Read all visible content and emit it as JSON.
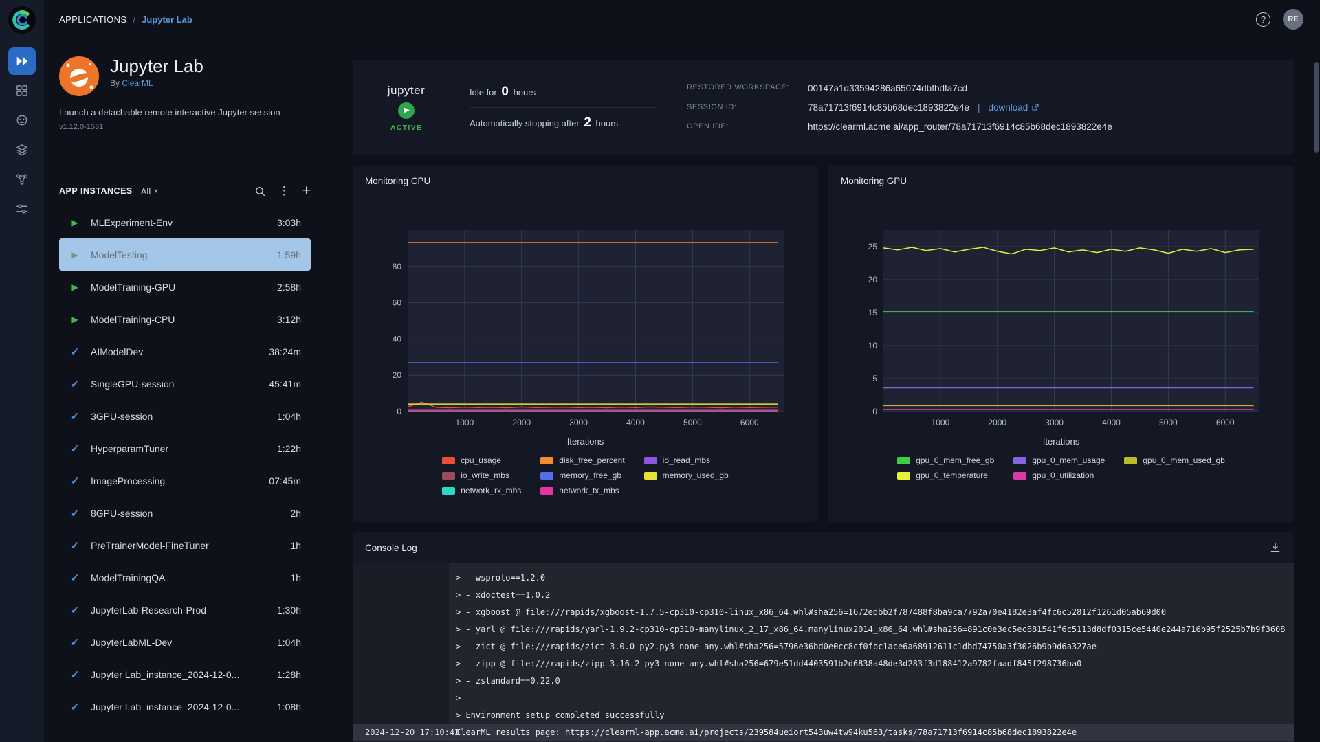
{
  "breadcrumb": {
    "section": "APPLICATIONS",
    "separator": "/",
    "current": "Jupyter Lab"
  },
  "header": {
    "avatar_initials": "RE"
  },
  "icons": {
    "play": "▶",
    "check": "✓",
    "kebab": "⋮",
    "plus": "+",
    "chevron_down": "▾",
    "help": "?"
  },
  "nav_rail": {
    "items": [
      "applications",
      "dashboard",
      "models",
      "datasets",
      "pipelines",
      "workers"
    ]
  },
  "app": {
    "title": "Jupyter Lab",
    "byline_prefix": "By",
    "byline_link": "ClearML",
    "description": "Launch a detachable remote interactive Jupyter session",
    "version": "v1.12.0-1531"
  },
  "instances_panel": {
    "title": "APP INSTANCES",
    "filter_label": "All",
    "instances": [
      {
        "name": "MLExperiment-Env",
        "duration": "3:03h",
        "status": "running"
      },
      {
        "name": "ModelTesting",
        "duration": "1:59h",
        "status": "running",
        "selected": true
      },
      {
        "name": "ModelTraining-GPU",
        "duration": "2:58h",
        "status": "running"
      },
      {
        "name": "ModelTraining-CPU",
        "duration": "3:12h",
        "status": "running"
      },
      {
        "name": "AIModelDev",
        "duration": "38:24m",
        "status": "completed"
      },
      {
        "name": "SingleGPU-session",
        "duration": "45:41m",
        "status": "completed"
      },
      {
        "name": "3GPU-session",
        "duration": "1:04h",
        "status": "completed"
      },
      {
        "name": "HyperparamTuner",
        "duration": "1:22h",
        "status": "completed"
      },
      {
        "name": "ImageProcessing",
        "duration": "07:45m",
        "status": "completed"
      },
      {
        "name": "8GPU-session",
        "duration": "2h",
        "status": "completed"
      },
      {
        "name": "PreTrainerModel-FineTuner",
        "duration": "1h",
        "status": "completed"
      },
      {
        "name": "ModelTrainingQA",
        "duration": "1h",
        "status": "completed"
      },
      {
        "name": "JupyterLab-Research-Prod",
        "duration": "1:30h",
        "status": "completed"
      },
      {
        "name": "JupyterLabML-Dev",
        "duration": "1:04h",
        "status": "completed"
      },
      {
        "name": "Jupyter Lab_instance_2024-12-0...",
        "duration": "1:28h",
        "status": "completed"
      },
      {
        "name": "Jupyter Lab_instance_2024-12-0...",
        "duration": "1:08h",
        "status": "completed"
      }
    ]
  },
  "session": {
    "logo_text": "jupyter",
    "status": "ACTIVE",
    "idle": {
      "prefix": "Idle for",
      "value": "0",
      "suffix": "hours"
    },
    "autostop": {
      "prefix": "Automatically stopping after",
      "value": "2",
      "suffix": "hours"
    },
    "info": [
      {
        "label": "RESTORED WORKSPACE:",
        "value": "00147a1d33594286a65074dbfbdfa7cd"
      },
      {
        "label": "SESSION ID:",
        "value": "78a71713f6914c85b68dec1893822e4e",
        "separator": "|",
        "link": "download"
      },
      {
        "label": "OPEN IDE:",
        "value": "https://clearml.acme.ai/app_router/78a71713f6914c85b68dec1893822e4e"
      }
    ]
  },
  "colors": {
    "accent_blue": "#5a9be0",
    "active_green": "#43b14b",
    "selected_row": "#a4c6e8",
    "running_icon": "#3fb94d",
    "completed_icon": "#4a97e8"
  },
  "chart_data": [
    {
      "type": "line",
      "title": "Monitoring CPU",
      "xlabel": "Iterations",
      "ylabel": "",
      "xlim": [
        0,
        6600
      ],
      "ylim": [
        0,
        100
      ],
      "xticks": [
        1000,
        2000,
        3000,
        4000,
        5000,
        6000
      ],
      "yticks": [
        0,
        20,
        40,
        60,
        80
      ],
      "x": [
        0,
        250,
        500,
        750,
        1000,
        1250,
        1500,
        1750,
        2000,
        2250,
        2500,
        2750,
        3000,
        3250,
        3500,
        3750,
        4000,
        4250,
        4500,
        4750,
        5000,
        5250,
        5500,
        5750,
        6000,
        6250,
        6500
      ],
      "series": [
        {
          "name": "cpu_usage",
          "color": "#e8503a",
          "values": [
            2.6,
            5.1,
            2.3,
            2.1,
            2.4,
            2.2,
            2.3,
            2.1,
            2.5,
            2.2,
            2.3,
            2.4,
            2.2,
            2.3,
            2.1,
            2.4,
            2.2,
            2.5,
            2.3,
            2.2,
            2.4,
            2.3,
            2.1,
            2.4,
            2.2,
            2.3,
            2.4
          ]
        },
        {
          "name": "disk_free_percent",
          "color": "#f28d2c",
          "const": 93.2
        },
        {
          "name": "io_read_mbs",
          "color": "#8d55e0",
          "const": 0.4
        },
        {
          "name": "io_write_mbs",
          "color": "#a04a60",
          "const": 0.7
        },
        {
          "name": "memory_free_gb",
          "color": "#5470e8",
          "const": 26.9
        },
        {
          "name": "memory_used_gb",
          "color": "#e6e233",
          "const": 4.1
        },
        {
          "name": "network_rx_mbs",
          "color": "#2ed9c3",
          "const": 0.2
        },
        {
          "name": "network_tx_mbs",
          "color": "#e832a0",
          "const": 0.1
        }
      ]
    },
    {
      "type": "line",
      "title": "Monitoring GPU",
      "xlabel": "Iterations",
      "ylabel": "",
      "xlim": [
        0,
        6600
      ],
      "ylim": [
        0,
        27.5
      ],
      "xticks": [
        1000,
        2000,
        3000,
        4000,
        5000,
        6000
      ],
      "yticks": [
        0,
        5,
        10,
        15,
        20,
        25
      ],
      "x": [
        0,
        250,
        500,
        750,
        1000,
        1250,
        1500,
        1750,
        2000,
        2250,
        2500,
        2750,
        3000,
        3250,
        3500,
        3750,
        4000,
        4250,
        4500,
        4750,
        5000,
        5250,
        5500,
        5750,
        6000,
        6250,
        6500
      ],
      "series": [
        {
          "name": "gpu_0_mem_free_gb",
          "color": "#3ecb4a",
          "const": 15.2
        },
        {
          "name": "gpu_0_mem_usage",
          "color": "#8565e0",
          "const": 3.6
        },
        {
          "name": "gpu_0_mem_used_gb",
          "color": "#b8bd28",
          "const": 0.9
        },
        {
          "name": "gpu_0_temperature",
          "color": "#e8f03c",
          "values": [
            24.8,
            24.5,
            24.9,
            24.4,
            24.7,
            24.2,
            24.6,
            24.9,
            24.3,
            23.9,
            24.6,
            24.4,
            24.8,
            24.2,
            24.5,
            24.1,
            24.6,
            24.3,
            24.8,
            24.5,
            24.0,
            24.6,
            24.3,
            24.7,
            24.1,
            24.5,
            24.6
          ]
        },
        {
          "name": "gpu_0_utilization",
          "color": "#d93aa6",
          "const": 0.3
        }
      ]
    }
  ],
  "console": {
    "title": "Console Log",
    "lines": [
      {
        "text": "> - wsproto==1.2.0"
      },
      {
        "text": "> - xdoctest==1.0.2"
      },
      {
        "text": "> - xgboost @ file:///rapids/xgboost-1.7.5-cp310-cp310-linux_x86_64.whl#sha256=1672edbb2f787488f8ba9ca7792a70e4182e3af4fc6c52812f1261d05ab69d00"
      },
      {
        "text": "> - yarl @ file:///rapids/yarl-1.9.2-cp310-cp310-manylinux_2_17_x86_64.manylinux2014_x86_64.whl#sha256=891c0e3ec5ec881541f6c5113d8df0315ce5440e244a716b95f2525b7b9f3608"
      },
      {
        "text": "> - zict @ file:///rapids/zict-3.0.0-py2.py3-none-any.whl#sha256=5796e36bd0e0cc8cf0fbc1ace6a68912611c1dbd74750a3f3026b9b9d6a327ae"
      },
      {
        "text": "> - zipp @ file:///rapids/zipp-3.16.2-py3-none-any.whl#sha256=679e51dd4403591b2d6838a48de3d283f3d188412a9782faadf845f298736ba0"
      },
      {
        "text": "> - zstandard==0.22.0"
      },
      {
        "text": ">"
      },
      {
        "text": "> Environment setup completed successfully"
      },
      {
        "timestamp": "2024-12-20 17:10:43",
        "text": "ClearML results page: https://clearml-app.acme.ai/projects/239584ueiort543uw4tw94ku563/tasks/78a71713f6914c85b68dec1893822e4e",
        "highlight": true
      }
    ]
  }
}
